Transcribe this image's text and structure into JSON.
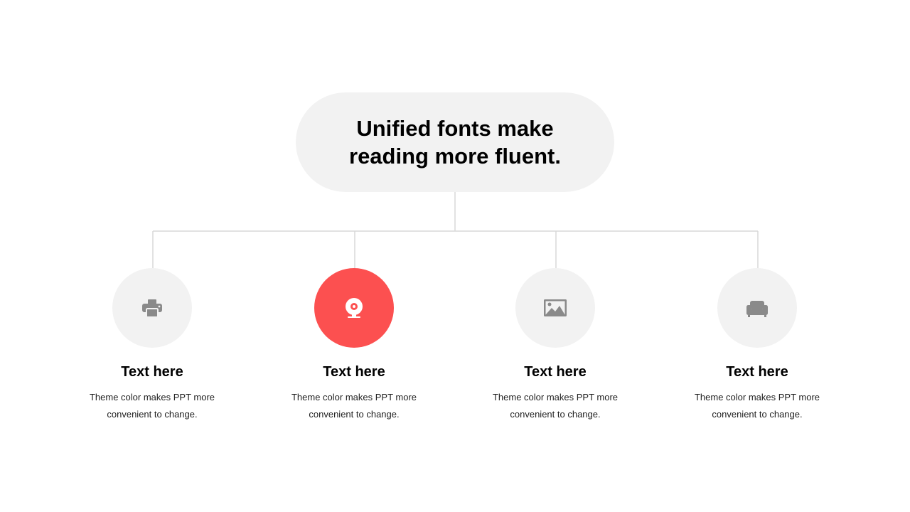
{
  "title": {
    "text": "Unified fonts make reading more fluent."
  },
  "colors": {
    "accent": "#fc5050",
    "pill_background": "#f2f2f2",
    "icon_gray": "#8a8a8a",
    "connector_line": "#d9d9d9"
  },
  "nodes": [
    {
      "icon": "printer-icon",
      "title": "Text here",
      "desc": "Theme color makes PPT more convenient to change.",
      "active": false
    },
    {
      "icon": "webcam-icon",
      "title": "Text here",
      "desc": "Theme color makes PPT more convenient to change.",
      "active": true
    },
    {
      "icon": "image-icon",
      "title": "Text here",
      "desc": "Theme color makes PPT more convenient to change.",
      "active": false
    },
    {
      "icon": "sofa-icon",
      "title": "Text here",
      "desc": "Theme color makes PPT more convenient to change.",
      "active": false
    }
  ]
}
